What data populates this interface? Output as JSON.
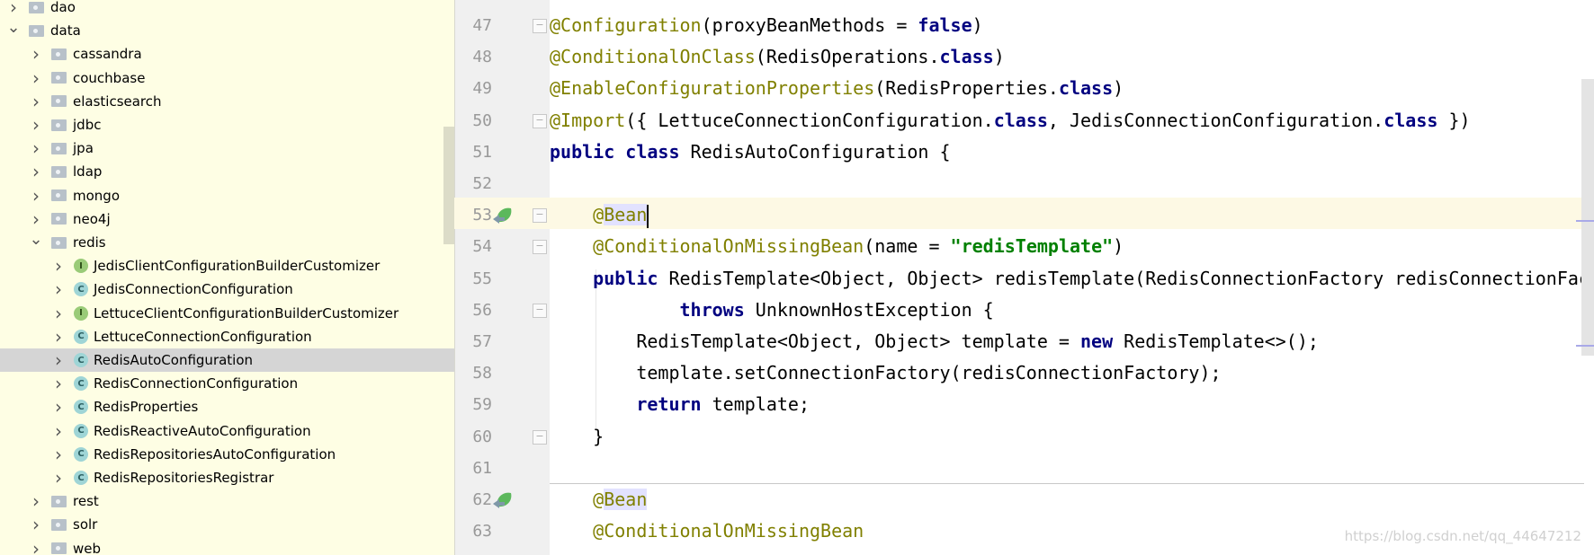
{
  "sidebar": {
    "items": [
      {
        "label": "dao",
        "level": 0,
        "expanded": false,
        "type": "folder"
      },
      {
        "label": "data",
        "level": 0,
        "expanded": true,
        "type": "folder"
      },
      {
        "label": "cassandra",
        "level": 1,
        "expanded": false,
        "type": "folder"
      },
      {
        "label": "couchbase",
        "level": 1,
        "expanded": false,
        "type": "folder"
      },
      {
        "label": "elasticsearch",
        "level": 1,
        "expanded": false,
        "type": "folder"
      },
      {
        "label": "jdbc",
        "level": 1,
        "expanded": false,
        "type": "folder"
      },
      {
        "label": "jpa",
        "level": 1,
        "expanded": false,
        "type": "folder"
      },
      {
        "label": "ldap",
        "level": 1,
        "expanded": false,
        "type": "folder"
      },
      {
        "label": "mongo",
        "level": 1,
        "expanded": false,
        "type": "folder"
      },
      {
        "label": "neo4j",
        "level": 1,
        "expanded": false,
        "type": "folder"
      },
      {
        "label": "redis",
        "level": 1,
        "expanded": true,
        "type": "folder"
      },
      {
        "label": "JedisClientConfigurationBuilderCustomizer",
        "level": 2,
        "expanded": false,
        "type": "interface"
      },
      {
        "label": "JedisConnectionConfiguration",
        "level": 2,
        "expanded": false,
        "type": "class"
      },
      {
        "label": "LettuceClientConfigurationBuilderCustomizer",
        "level": 2,
        "expanded": false,
        "type": "interface"
      },
      {
        "label": "LettuceConnectionConfiguration",
        "level": 2,
        "expanded": false,
        "type": "class"
      },
      {
        "label": "RedisAutoConfiguration",
        "level": 2,
        "expanded": false,
        "type": "class",
        "selected": true
      },
      {
        "label": "RedisConnectionConfiguration",
        "level": 2,
        "expanded": false,
        "type": "class"
      },
      {
        "label": "RedisProperties",
        "level": 2,
        "expanded": false,
        "type": "class"
      },
      {
        "label": "RedisReactiveAutoConfiguration",
        "level": 2,
        "expanded": false,
        "type": "class"
      },
      {
        "label": "RedisRepositoriesAutoConfiguration",
        "level": 2,
        "expanded": false,
        "type": "class"
      },
      {
        "label": "RedisRepositoriesRegistrar",
        "level": 2,
        "expanded": false,
        "type": "class"
      },
      {
        "label": "rest",
        "level": 1,
        "expanded": false,
        "type": "folder"
      },
      {
        "label": "solr",
        "level": 1,
        "expanded": false,
        "type": "folder"
      },
      {
        "label": "web",
        "level": 1,
        "expanded": false,
        "type": "folder"
      }
    ]
  },
  "editor": {
    "current_line": 53,
    "lines": [
      {
        "num": "47",
        "fold": true,
        "tokens": [
          [
            "@Configuration",
            "ann"
          ],
          [
            "(proxyBeanMethods = ",
            ""
          ],
          [
            "false",
            "kw"
          ],
          [
            ")",
            ""
          ]
        ]
      },
      {
        "num": "48",
        "tokens": [
          [
            "@ConditionalOnClass",
            "ann"
          ],
          [
            "(RedisOperations.",
            ""
          ],
          [
            "class",
            "kw"
          ],
          [
            ")",
            ""
          ]
        ]
      },
      {
        "num": "49",
        "tokens": [
          [
            "@EnableConfigurationProperties",
            "ann"
          ],
          [
            "(RedisProperties.",
            ""
          ],
          [
            "class",
            "kw"
          ],
          [
            ")",
            ""
          ]
        ]
      },
      {
        "num": "50",
        "fold": true,
        "tokens": [
          [
            "@Import",
            "ann"
          ],
          [
            "({ LettuceConnectionConfiguration.",
            ""
          ],
          [
            "class",
            "kw"
          ],
          [
            ", JedisConnectionConfiguration.",
            ""
          ],
          [
            "class",
            "kw"
          ],
          [
            " })",
            ""
          ]
        ]
      },
      {
        "num": "51",
        "tokens": [
          [
            "public class",
            "kw"
          ],
          [
            " RedisAutoConfiguration {",
            ""
          ]
        ]
      },
      {
        "num": "52",
        "tokens": []
      },
      {
        "num": "53",
        "fold": true,
        "bean": true,
        "tokens": [
          [
            "    ",
            ""
          ],
          [
            "@",
            "ann"
          ],
          [
            "Bean",
            "ann hl"
          ],
          [
            "",
            "caret"
          ]
        ]
      },
      {
        "num": "54",
        "fold": true,
        "tokens": [
          [
            "    ",
            ""
          ],
          [
            "@ConditionalOnMissingBean",
            "ann"
          ],
          [
            "(name = ",
            ""
          ],
          [
            "\"redisTemplate\"",
            "str"
          ],
          [
            ")",
            ""
          ]
        ]
      },
      {
        "num": "55",
        "tokens": [
          [
            "    ",
            ""
          ],
          [
            "public",
            "kw"
          ],
          [
            " RedisTemplate<Object, Object> redisTemplate(RedisConnectionFactory redisConnectionFactory)",
            ""
          ]
        ]
      },
      {
        "num": "56",
        "fold": true,
        "tokens": [
          [
            "            ",
            ""
          ],
          [
            "throws",
            "kw"
          ],
          [
            " UnknownHostException {",
            ""
          ]
        ]
      },
      {
        "num": "57",
        "tokens": [
          [
            "        RedisTemplate<Object, Object> template = ",
            ""
          ],
          [
            "new",
            "kw"
          ],
          [
            " RedisTemplate<>();",
            ""
          ]
        ]
      },
      {
        "num": "58",
        "tokens": [
          [
            "        template.setConnectionFactory(redisConnectionFactory);",
            ""
          ]
        ]
      },
      {
        "num": "59",
        "tokens": [
          [
            "        ",
            ""
          ],
          [
            "return",
            "kw"
          ],
          [
            " template;",
            ""
          ]
        ]
      },
      {
        "num": "60",
        "fold": true,
        "tokens": [
          [
            "    }",
            ""
          ]
        ]
      },
      {
        "num": "61",
        "tokens": []
      },
      {
        "num": "62",
        "bean": true,
        "tokens": [
          [
            "    ",
            ""
          ],
          [
            "@",
            "ann"
          ],
          [
            "Bean",
            "ann hl"
          ]
        ]
      },
      {
        "num": "63",
        "tokens": [
          [
            "    ",
            ""
          ],
          [
            "@ConditionalOnMissingBean",
            "ann"
          ]
        ]
      }
    ]
  },
  "watermark": "https://blog.csdn.net/qq_44647212",
  "colors": {
    "annotation": "#808000",
    "keyword": "#000080",
    "string": "#008000",
    "sidebar_bg": "#fefee4",
    "selection": "#d5d5d5"
  }
}
